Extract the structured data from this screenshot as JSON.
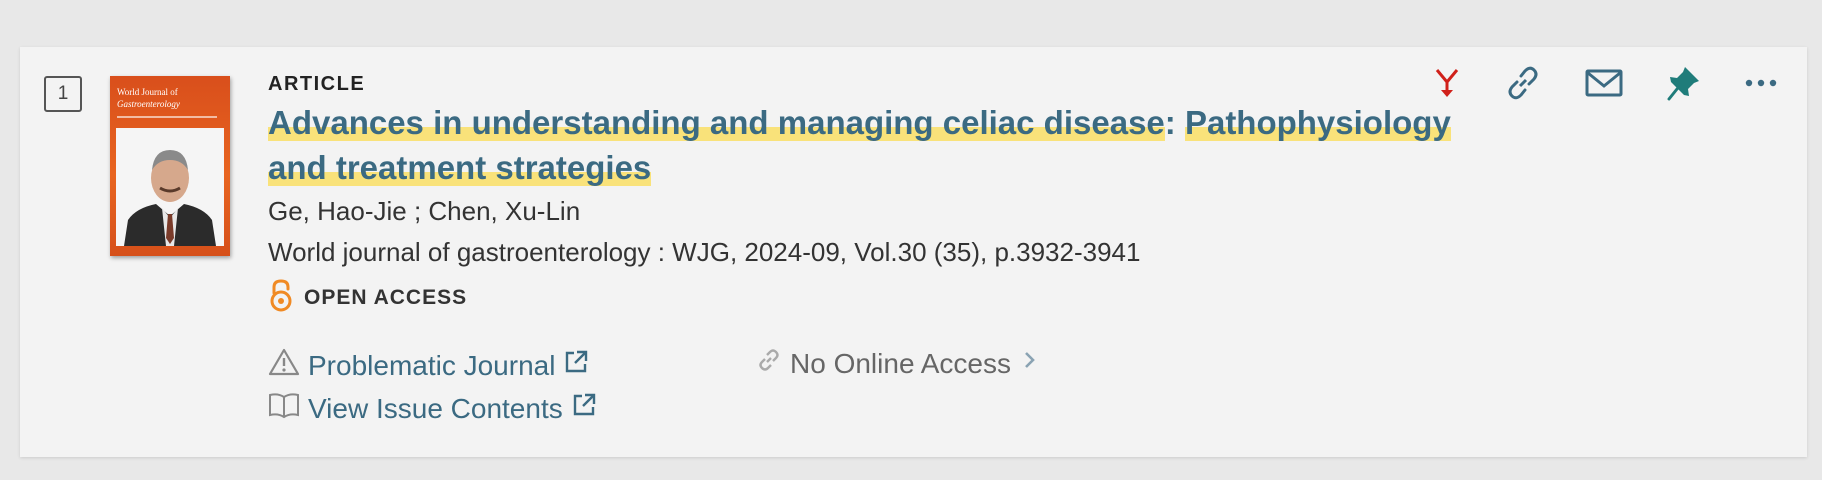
{
  "record": {
    "index": "1",
    "type_label": "ARTICLE",
    "title_part1": "Advances in understanding and managing celiac disease",
    "title_sep": ": ",
    "title_part2": "Pathophysiology and treatment strategies",
    "authors": "Ge, Hao-Jie ; Chen, Xu-Lin",
    "source": "World journal of gastroenterology : WJG, 2024-09, Vol.30 (35), p.3932-3941",
    "open_access_label": "OPEN ACCESS"
  },
  "cover": {
    "line1": "World Journal of",
    "line2": "Gastroenterology"
  },
  "links": {
    "problematic_journal": "Problematic Journal",
    "view_issue_contents": "View Issue Contents",
    "no_online_access": "No Online Access"
  },
  "icons": {
    "actions": [
      "citation-icon",
      "permalink-icon",
      "email-icon",
      "pin-icon",
      "more-options-icon"
    ]
  },
  "colors": {
    "link": "#3b6a82",
    "highlight": "#f9e27a",
    "open_access": "#f08a24",
    "citation_red": "#d0201a",
    "pin_teal": "#1f7c7a"
  }
}
